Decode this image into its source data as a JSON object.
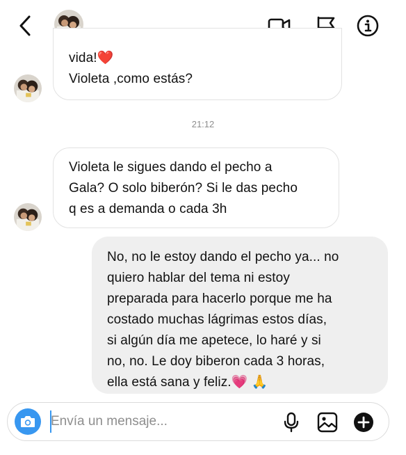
{
  "header": {
    "back_icon": "chevron-left-icon",
    "contact_avatar": "avatar",
    "actions": [
      "video-call-icon",
      "flag-icon",
      "info-icon"
    ]
  },
  "conversation": {
    "message_1": {
      "lines": [
        "vida!❤️",
        "Violeta ,como estás?"
      ]
    },
    "timestamp": "21:12",
    "message_2": {
      "lines": [
        "Violeta le sigues dando el pecho a",
        "Gala? O solo biberón? Si le das pecho",
        "q es a demanda o cada 3h"
      ]
    },
    "message_3": {
      "lines": [
        "No, no le estoy dando el pecho ya... no",
        "quiero hablar del tema ni estoy",
        "preparada para hacerlo porque me ha",
        "costado muchas lágrimas estos días,",
        "si algún día me apetece, lo haré y si",
        "no, no. Le doy biberon cada 3 horas,",
        "ella está sana y feliz.💗 🙏"
      ]
    }
  },
  "composer": {
    "placeholder": "Envía un mensaje...",
    "value": "",
    "icons": [
      "camera-icon",
      "microphone-icon",
      "gallery-icon",
      "add-icon"
    ],
    "accent_color": "#3897f0"
  },
  "colors": {
    "incoming_bubble_border": "#e2e2e2",
    "outgoing_bubble_bg": "#efefef",
    "timestamp": "#8e8e8e"
  }
}
